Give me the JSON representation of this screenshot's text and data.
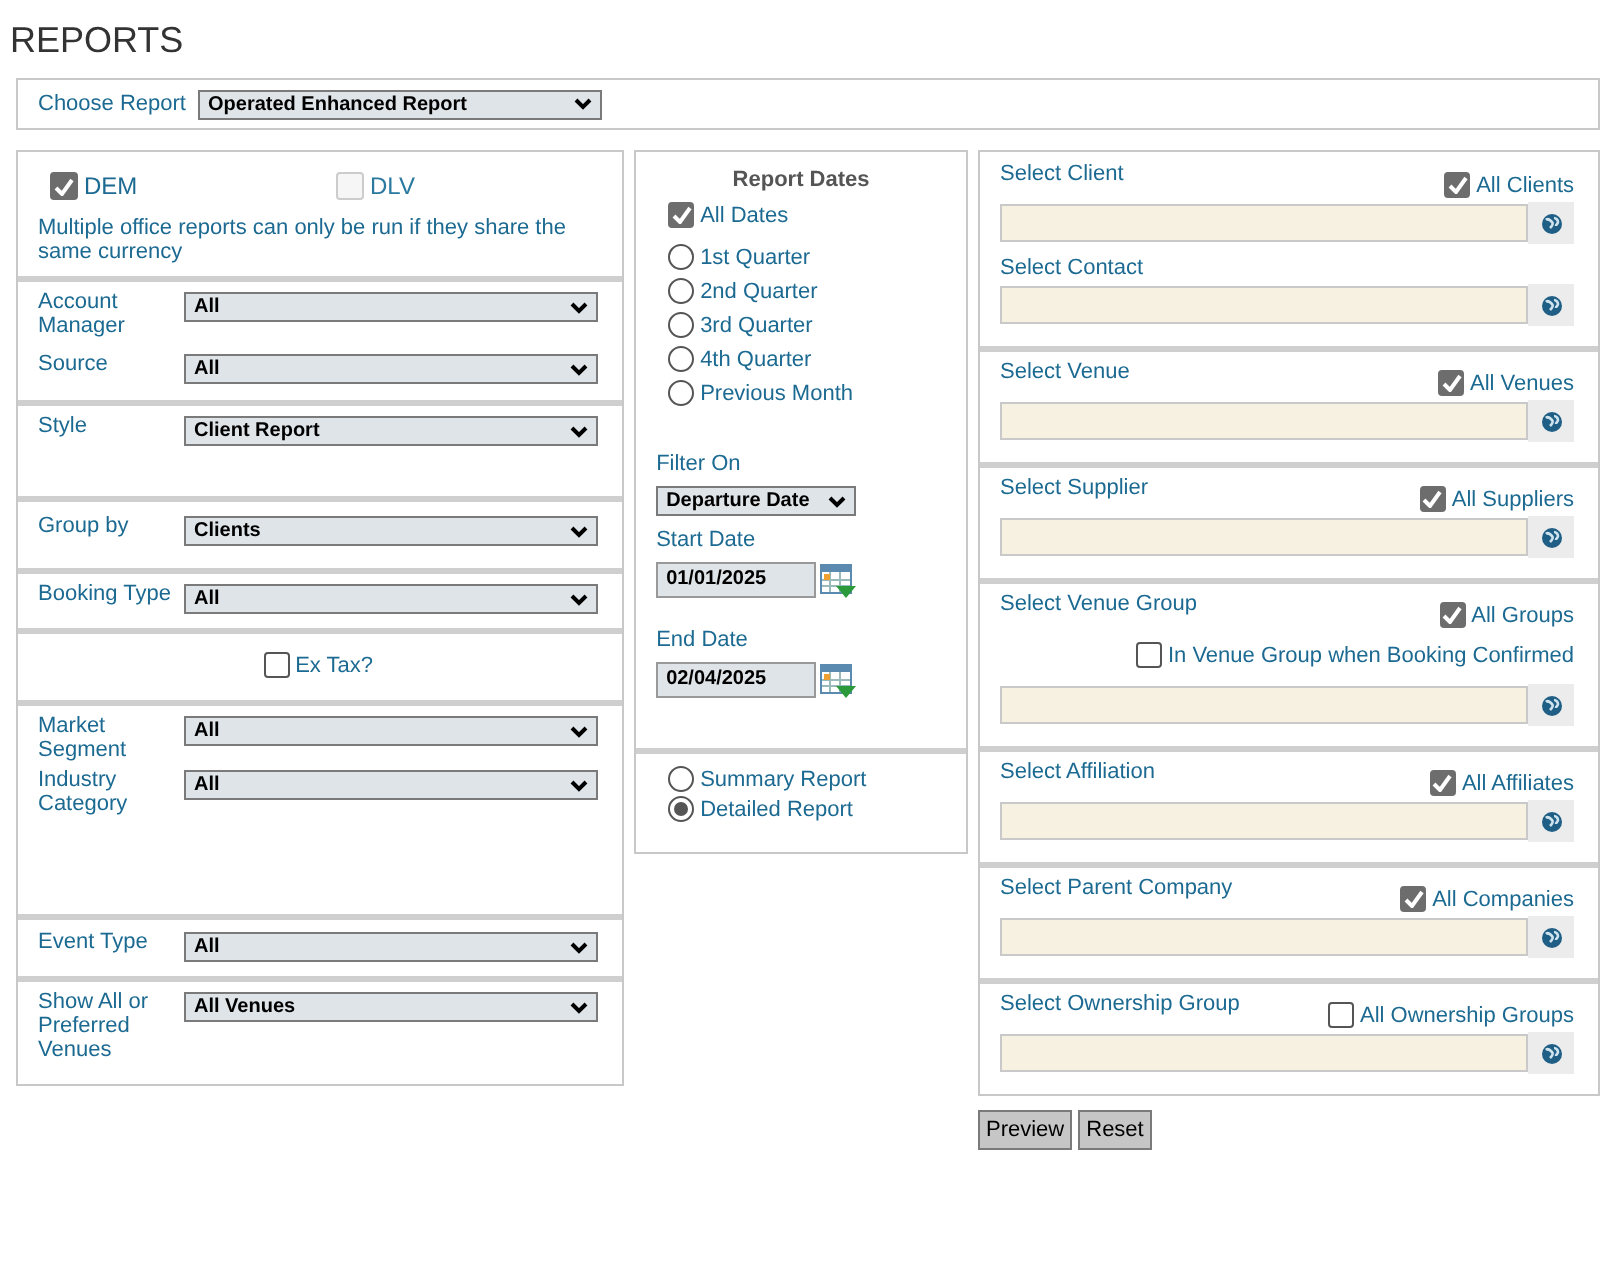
{
  "title": "REPORTS",
  "choose_report": {
    "label": "Choose Report",
    "value": "Operated Enhanced Report"
  },
  "left_sections": [
    {
      "items": [
        {
          "kind": "offices",
          "offices": [
            {
              "label": "DEM",
              "checked": true,
              "disabled": false
            },
            {
              "label": "DLV",
              "checked": false,
              "disabled": true
            }
          ]
        },
        {
          "kind": "note",
          "text": "Multiple office reports can only be run if they share the same currency"
        }
      ]
    },
    {
      "items": [
        {
          "kind": "select",
          "label": "Account Manager",
          "value": "All"
        },
        {
          "kind": "select",
          "label": "Source",
          "value": "All"
        }
      ]
    },
    {
      "items": [
        {
          "kind": "select",
          "label": "Style",
          "value": "Client Report"
        }
      ]
    },
    {
      "items": [
        {
          "kind": "select",
          "label": "Group by",
          "value": "Clients"
        }
      ]
    },
    {
      "items": [
        {
          "kind": "select",
          "label": "Booking Type",
          "value": "All"
        }
      ]
    },
    {
      "items": [
        {
          "kind": "checkbox",
          "label": "Ex Tax?",
          "checked": false
        }
      ]
    },
    {
      "items": [
        {
          "kind": "select",
          "label": "Market Segment",
          "value": "All"
        },
        {
          "kind": "select",
          "label": "Industry Category",
          "value": "All"
        }
      ]
    },
    {
      "items": [
        {
          "kind": "select",
          "label": "Event Type",
          "value": "All"
        }
      ]
    },
    {
      "items": [
        {
          "kind": "select",
          "label": "Show All or Preferred Venues",
          "value": "All Venues"
        }
      ]
    }
  ],
  "dates": {
    "heading": "Report Dates",
    "all_dates": {
      "label": "All Dates",
      "checked": true
    },
    "periods": [
      {
        "label": "1st Quarter",
        "selected": false
      },
      {
        "label": "2nd Quarter",
        "selected": false
      },
      {
        "label": "3rd Quarter",
        "selected": false
      },
      {
        "label": "4th Quarter",
        "selected": false
      },
      {
        "label": "Previous Month",
        "selected": false
      }
    ],
    "filter_label": "Filter On",
    "filter_value": "Departure Date",
    "start_label": "Start Date",
    "start_value": "01/01/2025",
    "end_label": "End Date",
    "end_value": "02/04/2025"
  },
  "report_types": [
    {
      "label": "Summary Report",
      "selected": false
    },
    {
      "label": "Detailed Report",
      "selected": true
    }
  ],
  "right_sections": [
    {
      "fields": [
        {
          "label": "Select Client",
          "all": {
            "label": "All Clients",
            "checked": true
          }
        },
        {
          "label": "Select Contact"
        }
      ]
    },
    {
      "fields": [
        {
          "label": "Select Venue",
          "all": {
            "label": "All Venues",
            "checked": true
          }
        }
      ]
    },
    {
      "fields": [
        {
          "label": "Select Supplier",
          "all": {
            "label": "All Suppliers",
            "checked": true
          }
        }
      ]
    },
    {
      "fields": [
        {
          "label": "Select Venue Group",
          "all": {
            "label": "All Groups",
            "checked": true
          },
          "extra": {
            "label": "In Venue Group when Booking Confirmed",
            "checked": false
          }
        }
      ]
    },
    {
      "fields": [
        {
          "label": "Select Affiliation",
          "all": {
            "label": "All Affiliates",
            "checked": true
          }
        }
      ]
    },
    {
      "fields": [
        {
          "label": "Select Parent Company",
          "all": {
            "label": "All Companies",
            "checked": true
          }
        }
      ]
    },
    {
      "fields": [
        {
          "label": "Select Ownership Group",
          "all": {
            "label": "All Ownership Groups",
            "checked": false
          }
        }
      ]
    }
  ],
  "buttons": [
    "Preview",
    "Reset"
  ]
}
